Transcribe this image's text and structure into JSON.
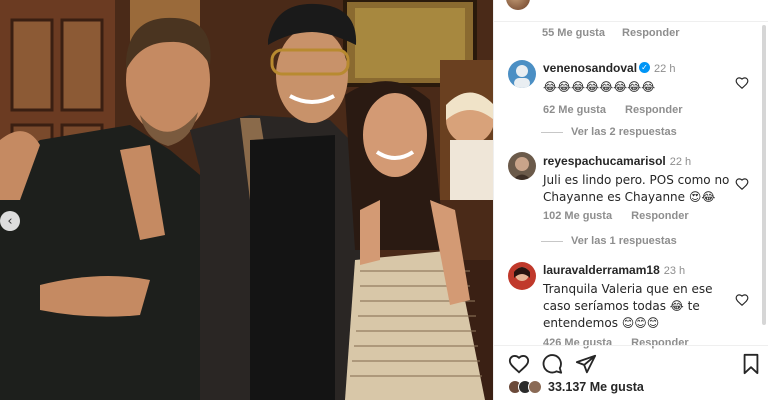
{
  "post": {
    "top_likes": "55 Me gusta",
    "top_reply": "Responder"
  },
  "comments": [
    {
      "user": "venenosandoval",
      "verified": true,
      "time": "22 h",
      "text": "😂😂😂😂😂😂😂😂",
      "likes": "62 Me gusta",
      "reply": "Responder",
      "view_replies": "Ver las 2 respuestas",
      "avatar_color": "#4b8fc4"
    },
    {
      "user": "reyespachucamarisol",
      "verified": false,
      "time": "22 h",
      "text": "Juli es lindo pero. POS como no Chayanne es Chayanne 😍😂",
      "likes": "102 Me gusta",
      "reply": "Responder",
      "view_replies": "Ver las 1 respuestas",
      "avatar_color": "#6b5a4a"
    },
    {
      "user": "lauravalderramam18",
      "verified": false,
      "time": "23 h",
      "text": "Tranquila Valeria que en ese caso seríamos todas 😂 te entendemos 😊😊😊",
      "likes": "426 Me gusta",
      "reply": "Responder",
      "avatar_color": "#c0392b"
    }
  ],
  "actions": {
    "likes_total": "33.137 Me gusta"
  },
  "icons": {
    "like": "heart-icon",
    "comment": "comment-icon",
    "share": "share-icon",
    "save": "bookmark-icon",
    "prev": "chevron-left-icon"
  },
  "colors": {
    "verified": "#0095f6",
    "muted": "#8e8e8e",
    "text": "#262626"
  }
}
